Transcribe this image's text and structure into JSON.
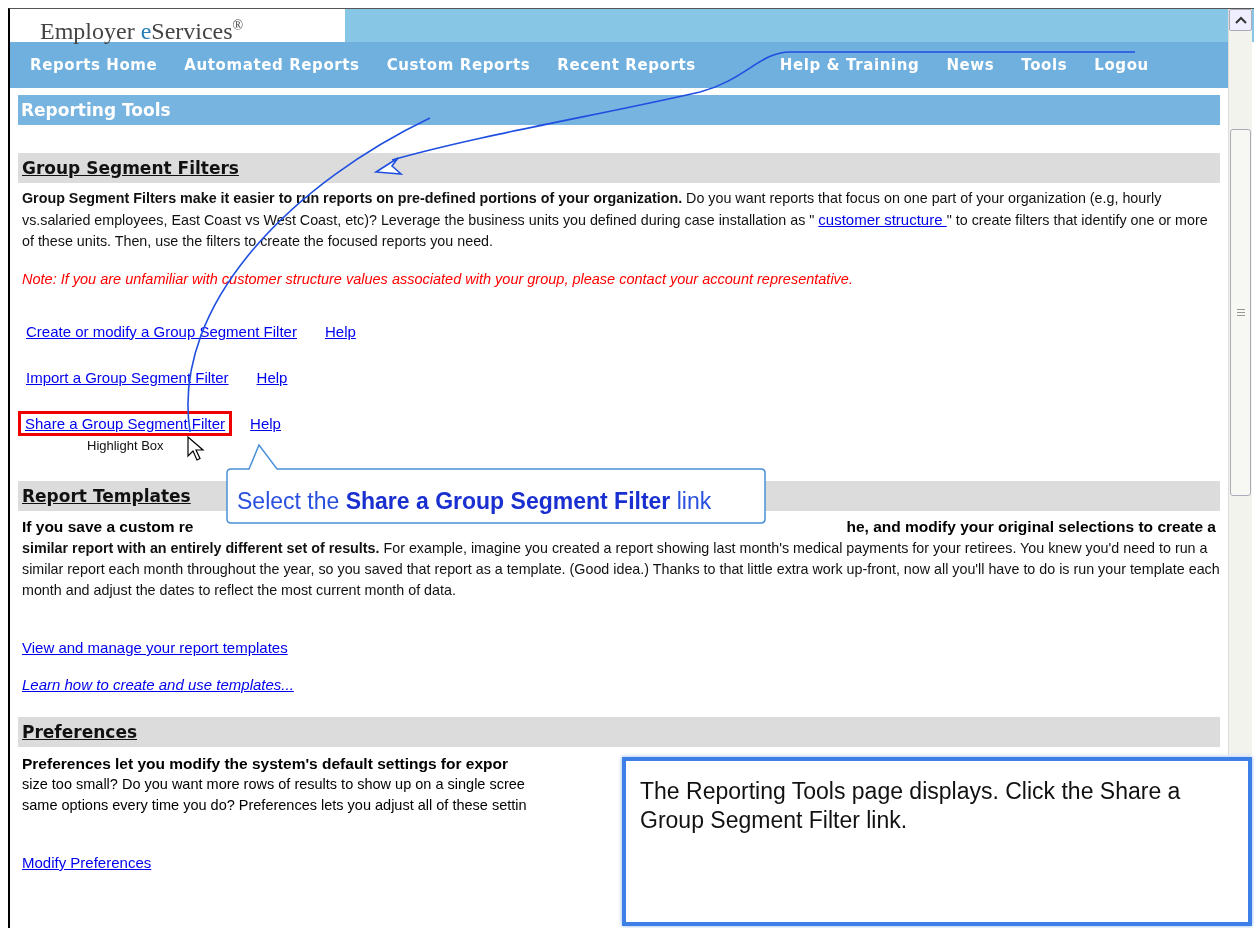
{
  "logo": {
    "parts": [
      "Employer ",
      "e",
      "Services"
    ],
    "mark": "®"
  },
  "nav": {
    "left": [
      "Reports Home",
      "Automated Reports",
      "Custom Reports",
      "Recent Reports"
    ],
    "right": [
      "Help & Training",
      "News",
      "Tools",
      "Logou"
    ]
  },
  "page_title": "Reporting Tools",
  "group_segment": {
    "heading": "Group Segment Filters",
    "intro_bold": "Group Segment Filters make it easier to run reports on pre-defined portions of your organization.",
    "intro_text": " Do you want reports that focus on one part of your organization (e.g, hourly vs.salaried employees, East Coast vs West Coast, etc)? Leverage the business units you defined during case installation as \" ",
    "intro_link": "customer structure ",
    "intro_tail": "\" to create filters that identify one or more of these units. Then, use the filters to create the focused reports you need.",
    "note": "Note: If you are unfamiliar with customer structure values associated with your group, please contact your account representative.",
    "links": [
      {
        "label": "Create or modify a Group Segment Filter ",
        "help": "Help",
        "highlighted": false
      },
      {
        "label": "Import a Group Segment Filter ",
        "help": "Help",
        "highlighted": false
      },
      {
        "label": "Share a Group Segment Filter",
        "help": "Help",
        "highlighted": true
      }
    ]
  },
  "highlight_label": "Highlight Box",
  "report_templates": {
    "heading": "Report Templates",
    "line1_start": "If you save a custom re",
    "line1_end": "he, and modify your original selections to create a",
    "rest": "**similar report with an entirely different set of results.** For example, imagine you created a report showing last month's medical payments for your retirees. You knew you'd need to run a similar report each month throughout the year, so you saved that report as a template. (Good idea.) Thanks to that little extra work up-front, now all you'll have to do is run your template each month and adjust the dates to reflect the most current month of data.",
    "links": [
      {
        "label": "View and manage your report templates",
        "italic": false
      },
      {
        "label": "Learn how to create and use templates...",
        "italic": true
      }
    ]
  },
  "preferences": {
    "heading": "Preferences",
    "lines": [
      {
        "text": "Preferences let you modify the system's default settings for expor",
        "bold": true
      },
      {
        "text": "size too small? Do you want more rows of results to show up on a single scree",
        "bold": false
      },
      {
        "text": "same options every time you do? Preferences lets you adjust all of these settin",
        "bold": false
      }
    ],
    "link": "Modify Preferences"
  },
  "callouts": [
    {
      "kind": "pointer",
      "text": "Select the **Share a Group Segment Filter** link"
    },
    {
      "kind": "box",
      "text": "The Reporting Tools page displays. Click the Share a Group Segment Filter link."
    }
  ]
}
